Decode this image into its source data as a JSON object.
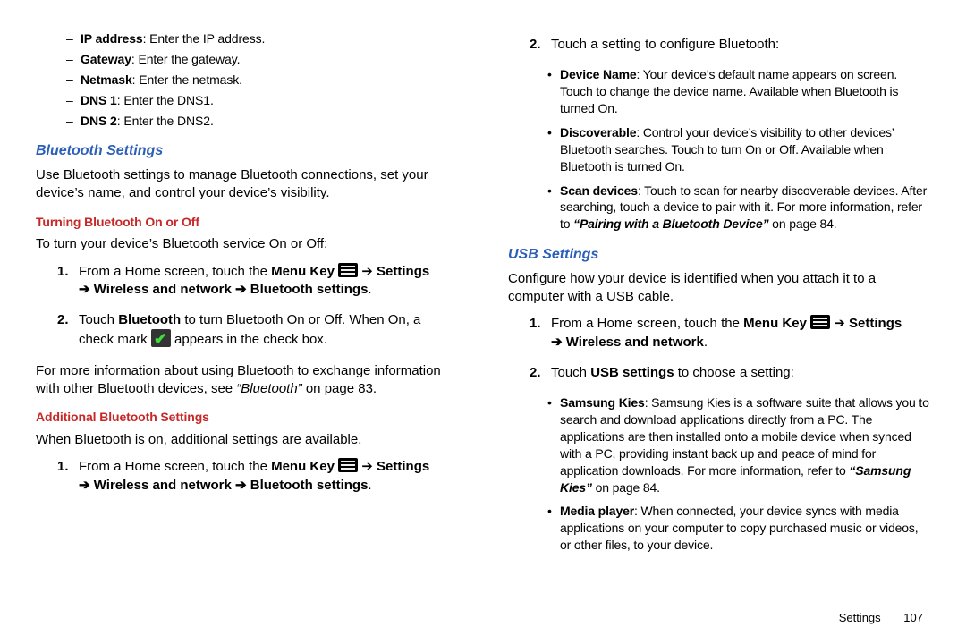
{
  "left": {
    "dashes": [
      {
        "term": "IP address",
        "desc": ": Enter the IP address."
      },
      {
        "term": "Gateway",
        "desc": ": Enter the gateway."
      },
      {
        "term": "Netmask",
        "desc": ": Enter the netmask."
      },
      {
        "term": "DNS 1",
        "desc": ": Enter the DNS1."
      },
      {
        "term": "DNS 2",
        "desc": ": Enter the DNS2."
      }
    ],
    "h2_bt": "Bluetooth Settings",
    "p_bt": "Use Bluetooth settings to manage Bluetooth connections, set your device’s name, and control your device’s visibility.",
    "h3_turn": "Turning Bluetooth On or Off",
    "p_turn": "To turn your device’s Bluetooth service On or Off:",
    "step1": {
      "pre": "From a Home screen, touch the ",
      "menukey": "Menu Key",
      "arrow1": " ➔ ",
      "settings": "Settings",
      "arrow2": "➔ ",
      "wn": "Wireless and network",
      "arrow3": " ➔ ",
      "bts": "Bluetooth settings",
      "dot": "."
    },
    "step2": {
      "a": "Touch ",
      "b_bt": "Bluetooth",
      "c": " to turn Bluetooth On or Off. When On, a check mark ",
      "d": " appears in the check box."
    },
    "p_more_a": "For more information about using Bluetooth to exchange information with other Bluetooth devices, see ",
    "p_more_ref": "“Bluetooth”",
    "p_more_b": " on page 83.",
    "h3_add": "Additional Bluetooth Settings",
    "p_add": "When Bluetooth is on, additional settings are available."
  },
  "right": {
    "step2intro": "Touch a setting to configure Bluetooth:",
    "bul_dev": {
      "term": "Device Name",
      "desc": ": Your device’s default name appears on screen. Touch to change the device name. Available when Bluetooth is turned On."
    },
    "bul_disc": {
      "term": "Discoverable",
      "desc": ": Control your device’s visibility to other devices’ Bluetooth searches. Touch to turn On or Off. Available when Bluetooth is turned On."
    },
    "bul_scan": {
      "term": "Scan devices",
      "a": ": Touch to scan for nearby discoverable devices. After searching, touch a device to pair with it. For more information, refer to ",
      "ref": "“Pairing with a Bluetooth Device”",
      "b": "  on page 84."
    },
    "h2_usb": "USB Settings",
    "p_usb": "Configure how your device is identified when you attach it to a computer with a USB cable.",
    "step1": {
      "pre": "From a Home screen, touch the ",
      "menukey": "Menu Key",
      "arrow1": " ➔ ",
      "settings": "Settings",
      "arrow2": "➔ ",
      "wn": "Wireless and network",
      "dot": "."
    },
    "step2": {
      "a": "Touch ",
      "b": "USB settings",
      "c": " to choose a setting:"
    },
    "bul_kies": {
      "term": "Samsung Kies",
      "a": ": Samsung Kies is a software suite that allows you to search and download applications directly from a PC. The applications are then installed onto a mobile device when synced with a PC, providing instant back up and peace of mind for application downloads. For more information, refer to ",
      "ref": "“Samsung Kies”",
      "b": "  on page 84."
    },
    "bul_mp": {
      "term": "Media player",
      "desc": ": When connected, your device syncs with media applications on your computer to copy purchased music or videos, or other files, to your device."
    }
  },
  "footer": {
    "label": "Settings",
    "page": "107"
  }
}
